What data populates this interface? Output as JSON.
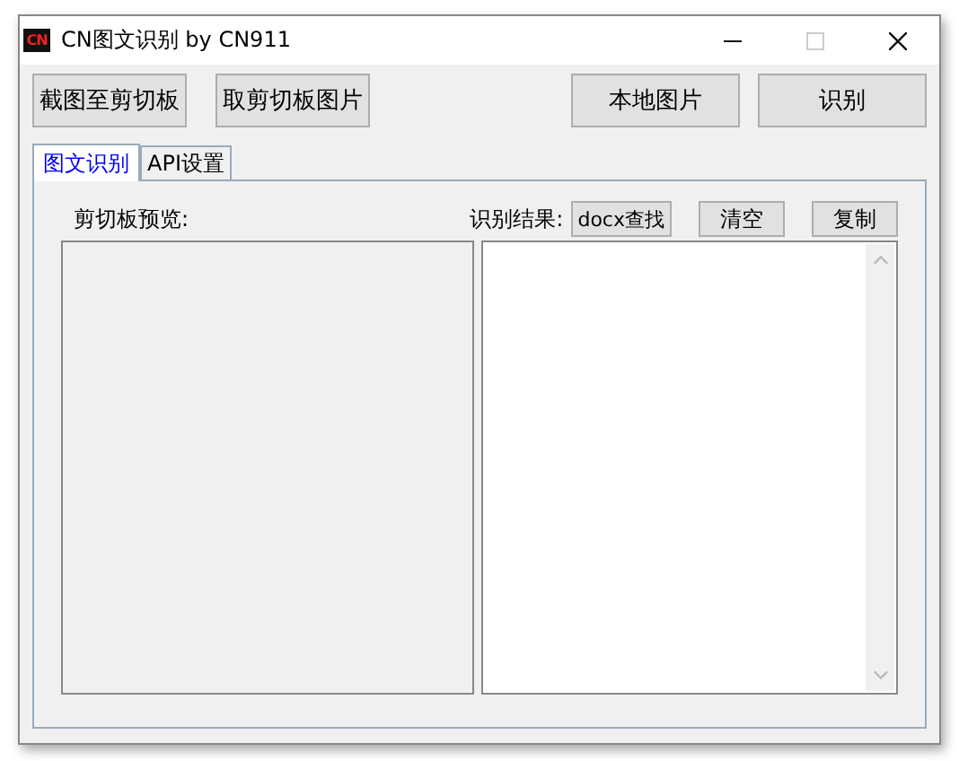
{
  "window": {
    "logo_text": "CN",
    "title": "CN图文识别 by CN911"
  },
  "toolbar": {
    "left_buttons": [
      "截图至剪切板",
      "取剪切板图片"
    ],
    "right_buttons": [
      "本地图片",
      "识别"
    ]
  },
  "tabs": [
    {
      "label": "图文识别",
      "selected": true
    },
    {
      "label": "API设置",
      "selected": false
    }
  ],
  "panel": {
    "preview_label": "剪切板预览:",
    "result_label": "识别结果:",
    "result_buttons": [
      "docx查找",
      "清空",
      "复制"
    ]
  }
}
